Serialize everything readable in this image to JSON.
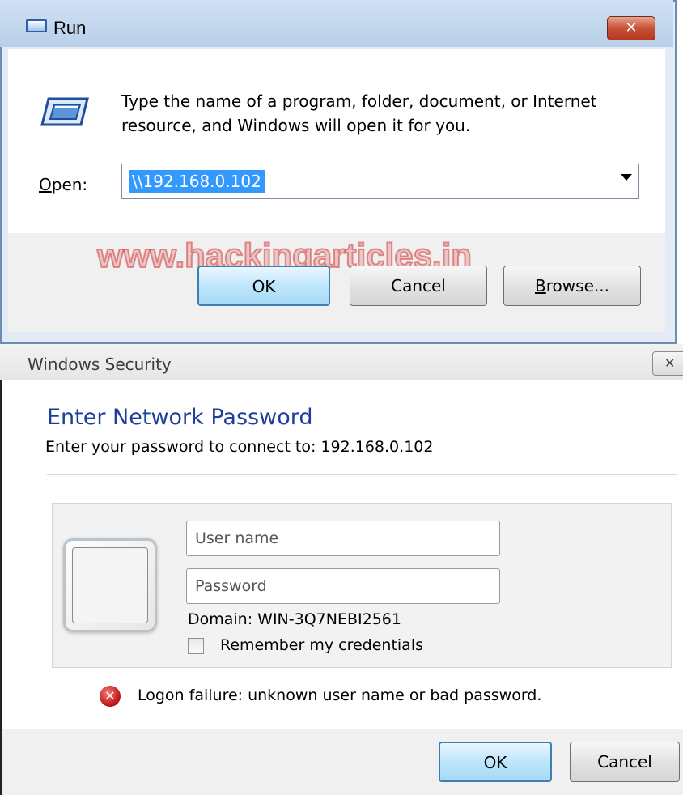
{
  "run_dialog": {
    "title": "Run",
    "close_glyph": "✕",
    "description": "Type the name of a program, folder, document, or Internet resource, and Windows will open it for you.",
    "open_label": "Open:",
    "open_value": "\\\\192.168.0.102",
    "watermark": "www.hackingarticles.in",
    "ok_label": "OK",
    "cancel_label": "Cancel",
    "browse_label": "Browse..."
  },
  "security_dialog": {
    "title": "Windows Security",
    "close_glyph": "✕",
    "heading": "Enter Network Password",
    "subheading": "Enter your password to connect to: 192.168.0.102",
    "username_placeholder": "User name",
    "password_placeholder": "Password",
    "domain": "Domain: WIN-3Q7NEBI2561",
    "remember_label": "Remember my credentials",
    "remember_checked": false,
    "error_message": "Logon failure: unknown user name or bad password.",
    "ok_label": "OK",
    "cancel_label": "Cancel"
  },
  "icons": {
    "run_title": "run-icon",
    "run_large": "run-icon",
    "error": "error-icon",
    "user_tile": "user-tile-icon"
  },
  "colors": {
    "selection": "#3399ff",
    "heading_blue": "#1e3e9a",
    "close_red": "#c75036"
  }
}
